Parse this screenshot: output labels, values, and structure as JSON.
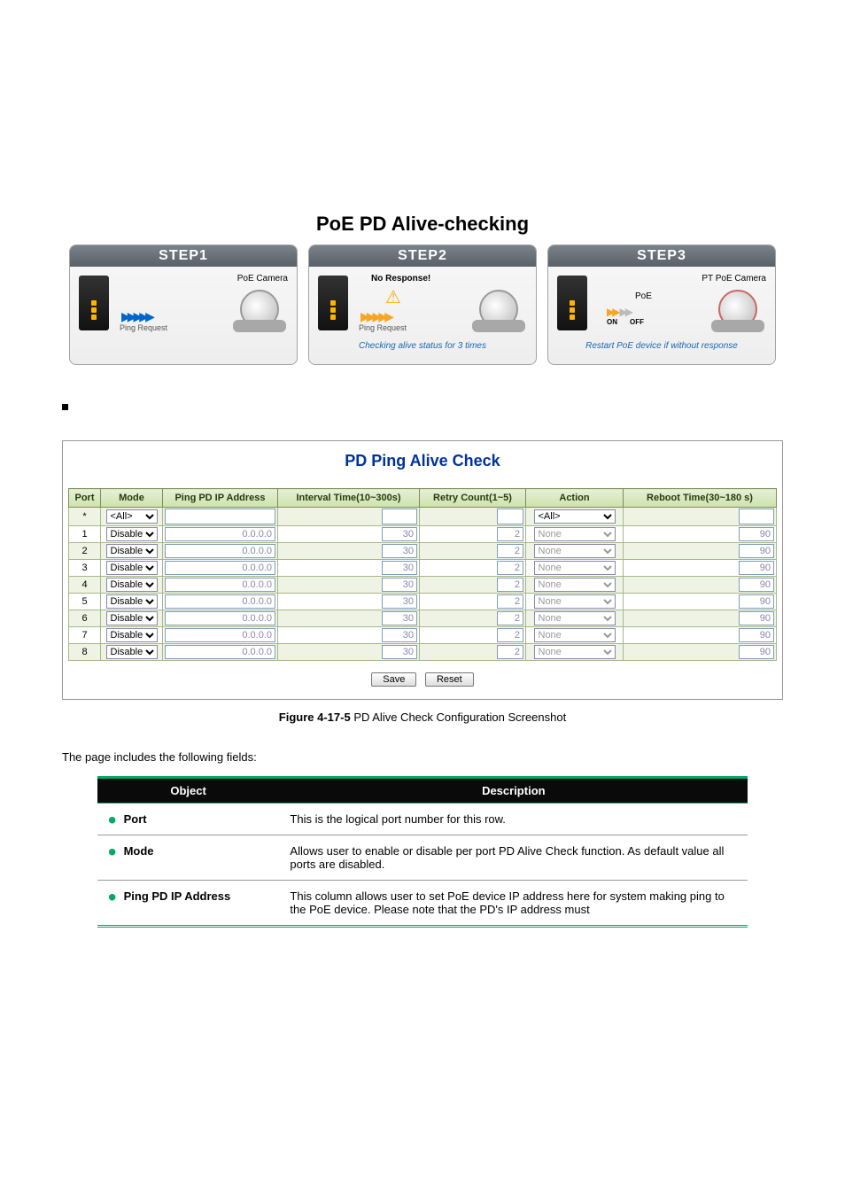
{
  "hero": {
    "title": "PoE PD Alive-checking"
  },
  "steps": [
    {
      "head": "STEP1",
      "cam_label": "PoE Camera",
      "ping_label": "Ping Request",
      "caption": ""
    },
    {
      "head": "STEP2",
      "no_response": "No Response!",
      "ping_label": "Ping Request",
      "caption": "Checking alive status for 3 times"
    },
    {
      "head": "STEP3",
      "cam_label": "PT PoE Camera",
      "poe_label": "PoE",
      "on_label": "ON",
      "off_label": "OFF",
      "caption": "Restart PoE device if without response"
    }
  ],
  "config": {
    "title": "PD Ping Alive Check",
    "headers": {
      "port": "Port",
      "mode": "Mode",
      "ip": "Ping PD IP Address",
      "interval": "Interval Time(10~300s)",
      "retry": "Retry Count(1~5)",
      "action": "Action",
      "reboot": "Reboot Time(30~180 s)"
    },
    "all_option": "<All>",
    "rows": [
      {
        "port": "*",
        "mode": "<All>",
        "ip": "",
        "interval": "",
        "retry": "",
        "action": "<All>",
        "reboot": ""
      },
      {
        "port": "1",
        "mode": "Disable",
        "ip": "0.0.0.0",
        "interval": "30",
        "retry": "2",
        "action": "None",
        "reboot": "90"
      },
      {
        "port": "2",
        "mode": "Disable",
        "ip": "0.0.0.0",
        "interval": "30",
        "retry": "2",
        "action": "None",
        "reboot": "90"
      },
      {
        "port": "3",
        "mode": "Disable",
        "ip": "0.0.0.0",
        "interval": "30",
        "retry": "2",
        "action": "None",
        "reboot": "90"
      },
      {
        "port": "4",
        "mode": "Disable",
        "ip": "0.0.0.0",
        "interval": "30",
        "retry": "2",
        "action": "None",
        "reboot": "90"
      },
      {
        "port": "5",
        "mode": "Disable",
        "ip": "0.0.0.0",
        "interval": "30",
        "retry": "2",
        "action": "None",
        "reboot": "90"
      },
      {
        "port": "6",
        "mode": "Disable",
        "ip": "0.0.0.0",
        "interval": "30",
        "retry": "2",
        "action": "None",
        "reboot": "90"
      },
      {
        "port": "7",
        "mode": "Disable",
        "ip": "0.0.0.0",
        "interval": "30",
        "retry": "2",
        "action": "None",
        "reboot": "90"
      },
      {
        "port": "8",
        "mode": "Disable",
        "ip": "0.0.0.0",
        "interval": "30",
        "retry": "2",
        "action": "None",
        "reboot": "90"
      }
    ],
    "save_label": "Save",
    "reset_label": "Reset"
  },
  "figure_caption_prefix": "Figure 4-17-5",
  "figure_caption_text": "PD Alive Check Configuration Screenshot",
  "desc_text": "The page includes the following fields:",
  "obj_table": {
    "head_object": "Object",
    "head_desc": "Description",
    "rows": [
      {
        "object": "Port",
        "desc": "This is the logical port number for this row."
      },
      {
        "object": "Mode",
        "desc": "Allows user to enable or disable per port PD Alive Check function. As default value all ports are disabled."
      },
      {
        "object": "Ping PD IP Address",
        "desc": "This column allows user to set PoE device IP address here for system making ping to the PoE device. Please note that the PD's IP address must"
      }
    ]
  }
}
